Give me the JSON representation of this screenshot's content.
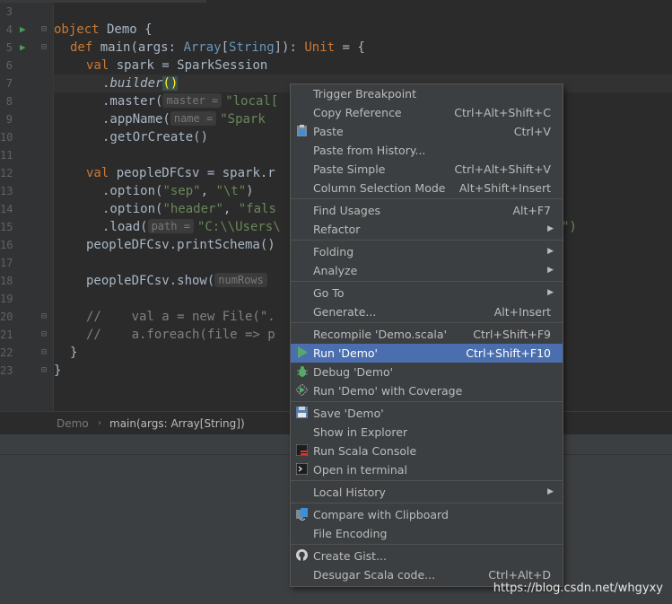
{
  "editor": {
    "line_numbers": [
      "3",
      "4",
      "5",
      "6",
      "7",
      "8",
      "9",
      "10",
      "11",
      "12",
      "13",
      "14",
      "15",
      "16",
      "17",
      "18",
      "19",
      "20",
      "21",
      "22",
      "23"
    ],
    "code": {
      "l4_kw": "object",
      "l4_rest": " Demo {",
      "l5_kw": "def",
      "l5_a": " main(args: ",
      "l5_type": "Array",
      "l5_b": "[",
      "l5_type2": "String",
      "l5_c": "]): ",
      "l5_type3": "Unit",
      "l5_d": " = {",
      "l6_kw": "val",
      "l6_rest": " spark = SparkSession",
      "l7_a": ".",
      "l7_fn": "builder",
      "l7_paren": "()",
      "l8_a": ".master(",
      "l8_hint": "master =",
      "l8_str": "\"local[",
      "l9_a": ".appName(",
      "l9_hint": "name =",
      "l9_str": "\"Spark",
      "l10": ".getOrCreate()",
      "l12_kw": "val",
      "l12_rest": " peopleDFCsv = spark.r",
      "l13_a": ".option(",
      "l13_s1": "\"sep\"",
      "l13_b": ", ",
      "l13_s2": "\"\\t\"",
      "l13_c": ")",
      "l14_a": ".option(",
      "l14_s1": "\"header\"",
      "l14_b": ", ",
      "l14_s2": "\"fals",
      "l15_a": ".load(",
      "l15_hint": "path =",
      "l15_str": "\"C:\\\\Users\\",
      "l15_tail": "\")",
      "l16": "peopleDFCsv.printSchema()",
      "l18_a": "peopleDFCsv.show(",
      "l18_hint": "numRows",
      "l20": "//    val a = new File(\".",
      "l21": "//    a.foreach(file => p",
      "l22": "}",
      "l23": "}"
    }
  },
  "breadcrumb": {
    "object": "Demo",
    "method": "main(args: Array[String])"
  },
  "context_menu": {
    "items": [
      {
        "label": "Trigger Breakpoint",
        "shortcut": "",
        "submenu": false,
        "icon": ""
      },
      {
        "label": "Copy Reference",
        "shortcut": "Ctrl+Alt+Shift+C",
        "submenu": false,
        "icon": ""
      },
      {
        "label": "Paste",
        "shortcut": "Ctrl+V",
        "submenu": false,
        "icon": "paste-icon"
      },
      {
        "label": "Paste from History...",
        "shortcut": "",
        "submenu": false,
        "icon": ""
      },
      {
        "label": "Paste Simple",
        "shortcut": "Ctrl+Alt+Shift+V",
        "submenu": false,
        "icon": ""
      },
      {
        "label": "Column Selection Mode",
        "shortcut": "Alt+Shift+Insert",
        "submenu": false,
        "icon": ""
      },
      {
        "label": "Find Usages",
        "shortcut": "Alt+F7",
        "submenu": false,
        "icon": ""
      },
      {
        "label": "Refactor",
        "shortcut": "",
        "submenu": true,
        "icon": ""
      },
      {
        "label": "Folding",
        "shortcut": "",
        "submenu": true,
        "icon": ""
      },
      {
        "label": "Analyze",
        "shortcut": "",
        "submenu": true,
        "icon": ""
      },
      {
        "label": "Go To",
        "shortcut": "",
        "submenu": true,
        "icon": ""
      },
      {
        "label": "Generate...",
        "shortcut": "Alt+Insert",
        "submenu": false,
        "icon": ""
      },
      {
        "label": "Recompile 'Demo.scala'",
        "shortcut": "Ctrl+Shift+F9",
        "submenu": false,
        "icon": ""
      },
      {
        "label": "Run 'Demo'",
        "shortcut": "Ctrl+Shift+F10",
        "submenu": false,
        "icon": "run-icon"
      },
      {
        "label": "Debug 'Demo'",
        "shortcut": "",
        "submenu": false,
        "icon": "debug-icon"
      },
      {
        "label": "Run 'Demo' with Coverage",
        "shortcut": "",
        "submenu": false,
        "icon": "coverage-icon"
      },
      {
        "label": "Save 'Demo'",
        "shortcut": "",
        "submenu": false,
        "icon": "save-icon"
      },
      {
        "label": "Show in Explorer",
        "shortcut": "",
        "submenu": false,
        "icon": ""
      },
      {
        "label": "Run Scala Console",
        "shortcut": "",
        "submenu": false,
        "icon": "scala-console-icon"
      },
      {
        "label": "Open in terminal",
        "shortcut": "",
        "submenu": false,
        "icon": "terminal-icon"
      },
      {
        "label": "Local History",
        "shortcut": "",
        "submenu": true,
        "icon": ""
      },
      {
        "label": "Compare with Clipboard",
        "shortcut": "",
        "submenu": false,
        "icon": "compare-icon"
      },
      {
        "label": "File Encoding",
        "shortcut": "",
        "submenu": false,
        "icon": ""
      },
      {
        "label": "Create Gist...",
        "shortcut": "",
        "submenu": false,
        "icon": "github-icon"
      },
      {
        "label": "Desugar Scala code...",
        "shortcut": "Ctrl+Alt+D",
        "submenu": false,
        "icon": ""
      }
    ],
    "selected_label": "Run 'Demo'",
    "submenu_glyph": "▶"
  },
  "watermark": "https://blog.csdn.net/whgyxy",
  "colors": {
    "background": "#2b2b2b",
    "menu_bg": "#3c3f41",
    "selected": "#4b6eaf",
    "keyword": "#cc7832",
    "string": "#6a8759",
    "type": "#6897bb"
  }
}
